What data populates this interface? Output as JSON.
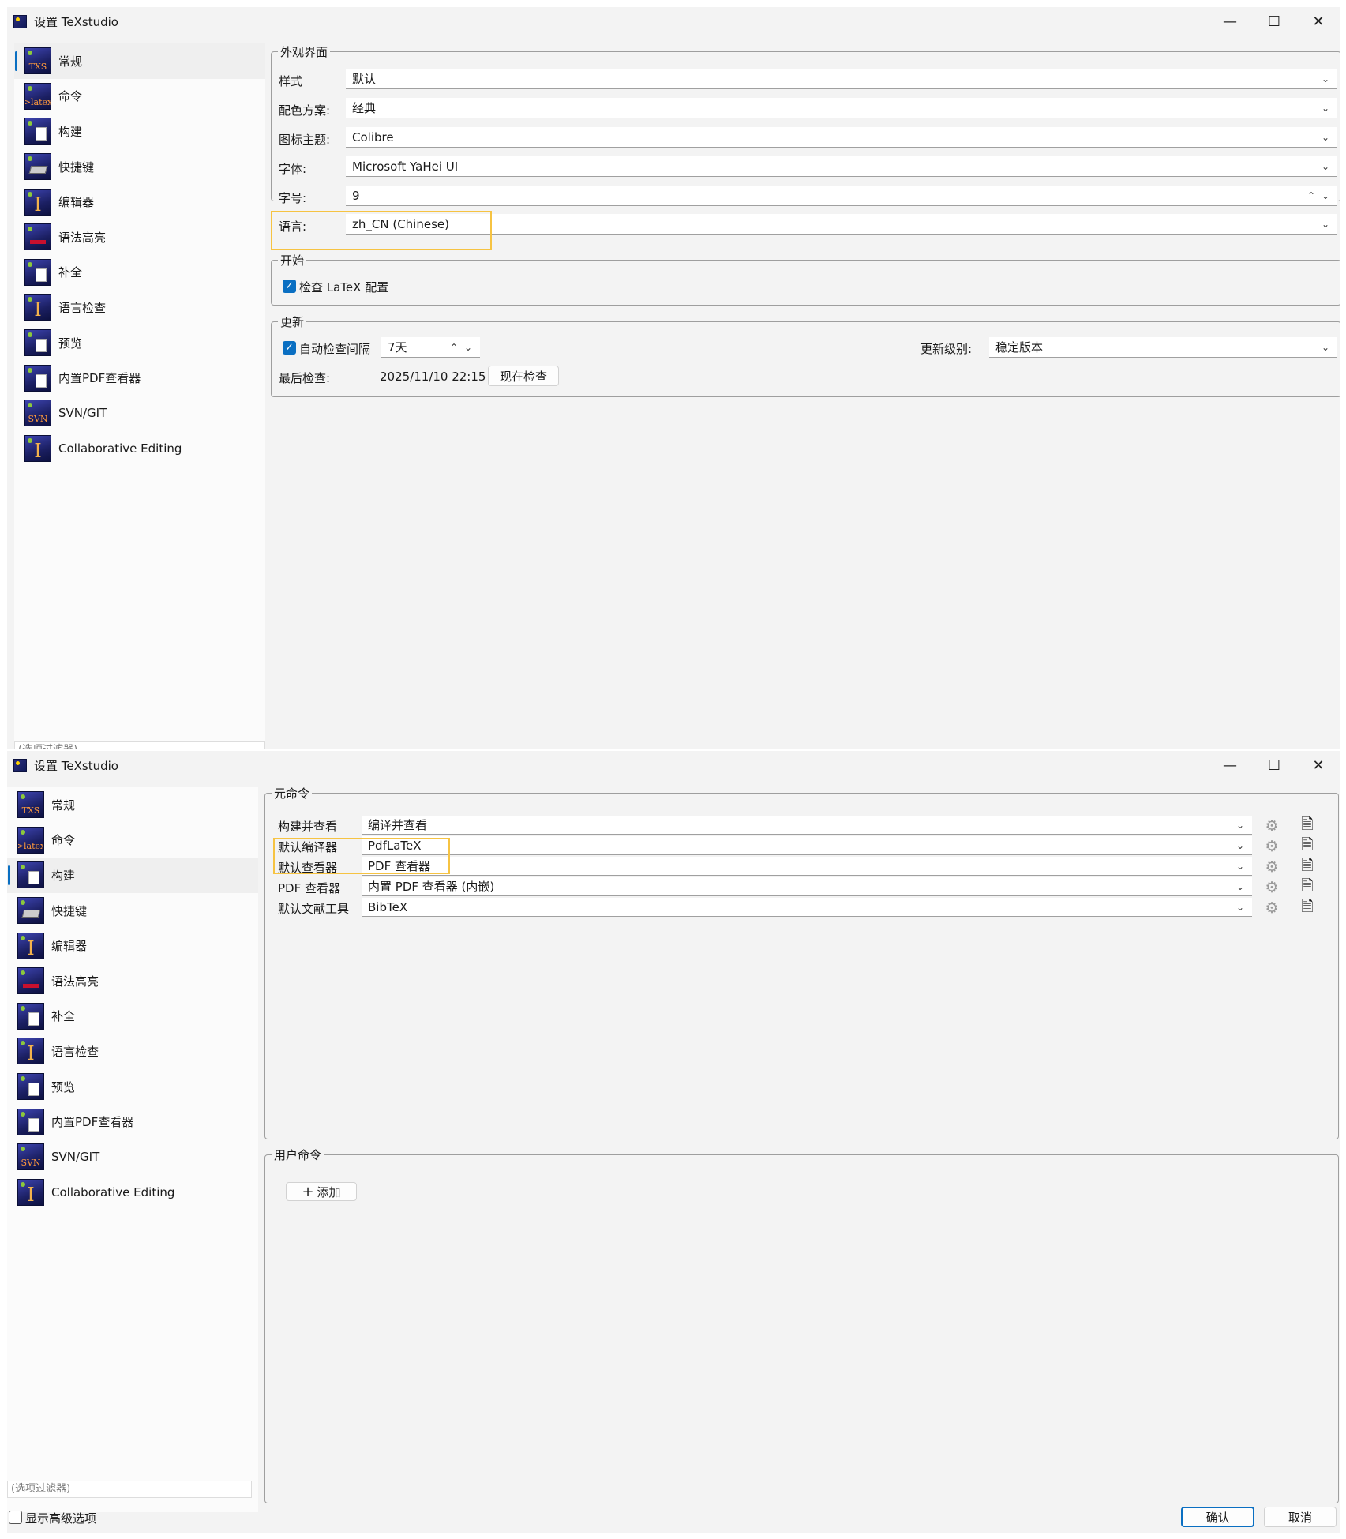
{
  "window1": {
    "title": "设置 TeXstudio",
    "sidebar": [
      {
        "label": "常规",
        "glyph": "TXS"
      },
      {
        "label": "命令",
        "glyph": ">latex"
      },
      {
        "label": "构建",
        "glyph": ""
      },
      {
        "label": "快捷键",
        "glyph": ""
      },
      {
        "label": "编辑器",
        "glyph": "I"
      },
      {
        "label": "语法高亮",
        "glyph": ""
      },
      {
        "label": "补全",
        "glyph": ""
      },
      {
        "label": "语言检查",
        "glyph": "I"
      },
      {
        "label": "预览",
        "glyph": ""
      },
      {
        "label": "内置PDF查看器",
        "glyph": ""
      },
      {
        "label": "SVN/GIT",
        "glyph": "SVN"
      },
      {
        "label": "Collaborative Editing",
        "glyph": "I"
      }
    ],
    "filter_placeholder": "(选项过滤器)",
    "appearance": {
      "group_title": "外观界面",
      "style_label": "样式",
      "style_value": "默认",
      "color_label": "配色方案:",
      "color_value": "经典",
      "icon_label": "图标主题:",
      "icon_value": "Colibre",
      "font_label": "字体:",
      "font_value": "Microsoft YaHei UI",
      "size_label": "字号:",
      "size_value": "9",
      "lang_label": "语言:",
      "lang_value": "zh_CN  (Chinese)"
    },
    "startup": {
      "group_title": "开始",
      "check_latex_label": "检查 LaTeX 配置"
    },
    "updates": {
      "group_title": "更新",
      "auto_label": "自动检查间隔",
      "interval_value": "7天",
      "level_label": "更新级别:",
      "level_value": "稳定版本",
      "last_label": "最后检查:",
      "last_value": "2025/11/10 22:15",
      "check_now_label": "现在检查"
    }
  },
  "window2": {
    "title": "设置 TeXstudio",
    "meta": {
      "group_title": "元命令",
      "rows": [
        {
          "label": "构建并查看",
          "value": "编译并查看"
        },
        {
          "label": "默认编译器",
          "value": "PdfLaTeX"
        },
        {
          "label": "默认查看器",
          "value": "PDF 查看器"
        },
        {
          "label": "PDF 查看器",
          "value": "内置 PDF 查看器 (内嵌)"
        },
        {
          "label": "默认文献工具",
          "value": "BibTeX"
        }
      ]
    },
    "user": {
      "group_title": "用户命令",
      "add_label": "添加"
    },
    "filter_placeholder": "(选项过滤器)",
    "advanced_label": "显示高级选项",
    "ok_label": "确认",
    "cancel_label": "取消"
  },
  "colors": {
    "accent": "#0a6fc2",
    "highlight": "#f6c342"
  },
  "icons": {
    "minimize": "—",
    "maximize": "☐",
    "close": "✕",
    "chevron_down": "⌄",
    "chevron_up": "⌃",
    "gear": "⚙",
    "document": "🗎",
    "plus": "+"
  }
}
